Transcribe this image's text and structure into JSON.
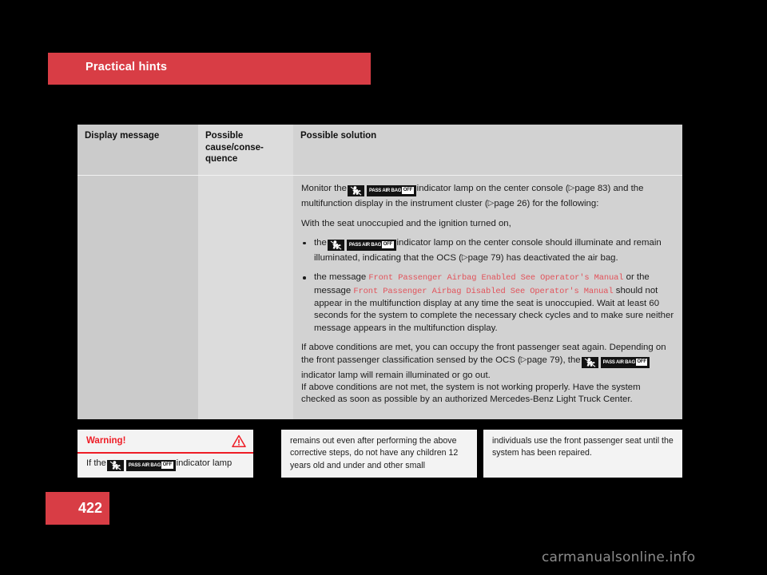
{
  "chapter": {
    "title": "Practical hints"
  },
  "table": {
    "headers": {
      "col1": "Display message",
      "col2": "Possible cause/conse-quence",
      "col3": "Possible solution"
    },
    "solution": {
      "intro_1a": "Monitor the",
      "intro_1b": "indicator lamp on the center console (",
      "intro_1c": "page 83) and the multifunction display in the instrument cluster (",
      "intro_1d": "page 26) for the following:",
      "intro_2": "With the seat unoccupied and the ignition turned on,",
      "bullet1_a": "the",
      "bullet1_b": "indicator lamp on the center console should illuminate and remain illuminated, indicating that the OCS (",
      "bullet1_c": "page 79) has deactivated the air bag.",
      "bullet2_a": "the message",
      "bullet2_msg1": "Front Passenger Airbag Enabled See Operator's Manual",
      "bullet2_b": "or the message",
      "bullet2_msg2": "Front Passenger Airbag Disabled See Operator's Manual",
      "bullet2_c": "should not appear in the multifunction display at any time the seat is unoccupied. Wait at least 60 seconds for the system to complete the necessary check cycles and to make sure neither message appears in the multifunction display.",
      "closing_1a": "If above conditions are met, you can occupy the front passenger seat again. Depending on the front passenger classification sensed by the OCS (",
      "closing_1b": "page 79), the",
      "closing_1c": "indicator lamp will remain illuminated or go out.",
      "closing_2": "If above conditions are not met, the system is not working properly. Have the system checked as soon as possible by an authorized Mercedes-Benz Light Truck Center."
    }
  },
  "warning": {
    "title": "Warning!",
    "body_a": "If the",
    "body_b": "indicator lamp",
    "col2": "remains out even after performing the above corrective steps, do not have any children 12 years old and under and other small",
    "col3": "individuals use the front passenger seat until the system has been repaired."
  },
  "lamp": {
    "text": "PASS AIR BAG",
    "off": "OFF"
  },
  "page_reference_arrow": "▷",
  "footer": {
    "page_number": "422",
    "watermark": "carmanualsonline.info"
  },
  "colors": {
    "brand_red": "#d83d45",
    "warning_red": "#ee1c25",
    "mono_red": "#e2525a",
    "col1_bg": "#cbcbcb",
    "col2_bg": "#dcdcdc",
    "col3_bg": "#d2d2d2",
    "warn_bg": "#f3f3f3"
  }
}
